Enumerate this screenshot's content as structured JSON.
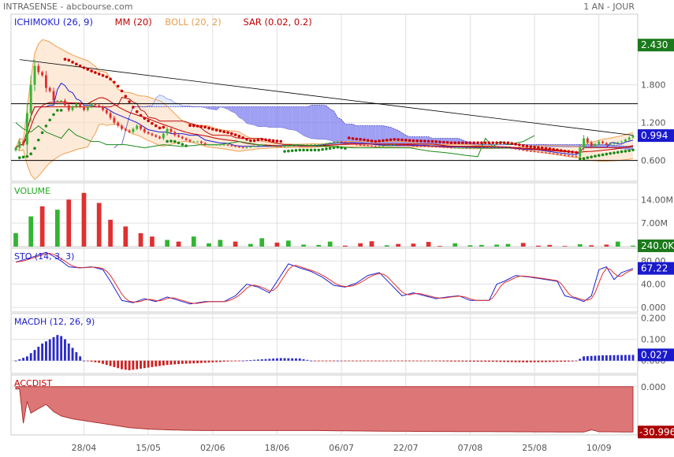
{
  "header": {
    "title": "INTRASENSE - abcbourse.com",
    "period": "1 AN - JOUR"
  },
  "colors": {
    "up": "#33b533",
    "down": "#e03030",
    "sar": "#cc0000",
    "sar_up": "#1a8a1a",
    "ichimoku_tenkan": "#1d1dd8",
    "ichimoku_kijun": "#c01010",
    "ichimoku_chikou": "#1a8a1a",
    "cloud_up": "#7f7ff0",
    "cloud_down": "#d8e6ff",
    "mm": "#c00000",
    "boll": "#f0a050",
    "boll_fill": "#fbdcc0",
    "sto_k": "#2020d0",
    "sto_d": "#e03030",
    "macd_pos": "#2b2bc8",
    "macd_neg": "#cc2222",
    "accdist_fill": "#dd7777",
    "badge_green": "#1b7a1b",
    "badge_blue": "#1a1acc",
    "badge_red": "#aa0000",
    "grid": "#e0e0e0"
  },
  "chart_data": [
    {
      "type": "line",
      "panel": "price",
      "legend": [
        {
          "label": "ICHIMOKU (26, 9)",
          "color": "#1d1dd8"
        },
        {
          "label": "MM (20)",
          "color": "#c00000"
        },
        {
          "label": "BOLL (20, 2)",
          "color": "#e8a050"
        },
        {
          "label": "SAR (0.02, 0.2)",
          "color": "#c00000"
        }
      ],
      "y_ticks": [
        "1.800",
        "1.200",
        "0.600"
      ],
      "y_tick_values": [
        1.8,
        1.2,
        0.6
      ],
      "highlight_values": [
        {
          "label": "2.430",
          "value": 2.43,
          "color": "#1b7a1b"
        },
        {
          "label": "0.994",
          "value": 0.994,
          "color": "#1a1acc"
        }
      ],
      "horizontal_levels": [
        1.5,
        0.6
      ],
      "trendline": [
        {
          "day": 1,
          "value": 2.2
        },
        {
          "day": 163,
          "value": 1.0
        }
      ],
      "ylim": [
        0.27,
        2.92
      ],
      "series_waypoints": {
        "close": [
          [
            0,
            0.8
          ],
          [
            1,
            0.9
          ],
          [
            2,
            0.85
          ],
          [
            3,
            1.35
          ],
          [
            4,
            1.8
          ],
          [
            5,
            2.1
          ],
          [
            6,
            2.0
          ],
          [
            7,
            1.95
          ],
          [
            8,
            1.75
          ],
          [
            9,
            1.7
          ],
          [
            10,
            1.55
          ],
          [
            12,
            1.55
          ],
          [
            14,
            1.4
          ],
          [
            16,
            1.5
          ],
          [
            18,
            1.4
          ],
          [
            20,
            1.5
          ],
          [
            22,
            1.45
          ],
          [
            24,
            1.35
          ],
          [
            26,
            1.2
          ],
          [
            28,
            1.1
          ],
          [
            30,
            1.05
          ],
          [
            32,
            1.15
          ],
          [
            34,
            1.05
          ],
          [
            36,
            1.0
          ],
          [
            38,
            0.95
          ],
          [
            40,
            1.1
          ],
          [
            42,
            1.0
          ],
          [
            44,
            0.95
          ],
          [
            46,
            0.9
          ],
          [
            48,
            0.9
          ],
          [
            50,
            0.85
          ],
          [
            55,
            0.85
          ],
          [
            60,
            0.8
          ],
          [
            65,
            0.85
          ],
          [
            70,
            0.82
          ],
          [
            75,
            0.85
          ],
          [
            80,
            0.85
          ],
          [
            85,
            0.9
          ],
          [
            90,
            0.85
          ],
          [
            95,
            0.82
          ],
          [
            100,
            0.85
          ],
          [
            105,
            0.83
          ],
          [
            110,
            0.82
          ],
          [
            115,
            0.8
          ],
          [
            120,
            0.8
          ],
          [
            125,
            0.8
          ],
          [
            130,
            0.8
          ],
          [
            135,
            0.75
          ],
          [
            140,
            0.72
          ],
          [
            145,
            0.68
          ],
          [
            148,
            0.66
          ],
          [
            150,
            0.95
          ],
          [
            152,
            0.82
          ],
          [
            154,
            0.9
          ],
          [
            156,
            0.85
          ],
          [
            160,
            0.9
          ],
          [
            163,
            0.994
          ]
        ],
        "sto": [
          [
            0,
            78
          ],
          [
            5,
            88
          ],
          [
            8,
            95
          ],
          [
            10,
            88
          ],
          [
            12,
            80
          ],
          [
            14,
            70
          ],
          [
            17,
            68
          ],
          [
            20,
            70
          ],
          [
            23,
            65
          ],
          [
            25,
            45
          ],
          [
            28,
            12
          ],
          [
            31,
            8
          ],
          [
            34,
            15
          ],
          [
            37,
            10
          ],
          [
            40,
            18
          ],
          [
            43,
            12
          ],
          [
            46,
            6
          ],
          [
            50,
            10
          ],
          [
            55,
            10
          ],
          [
            58,
            20
          ],
          [
            61,
            40
          ],
          [
            64,
            35
          ],
          [
            67,
            25
          ],
          [
            70,
            55
          ],
          [
            72,
            75
          ],
          [
            75,
            68
          ],
          [
            78,
            62
          ],
          [
            81,
            52
          ],
          [
            84,
            38
          ],
          [
            87,
            35
          ],
          [
            90,
            42
          ],
          [
            93,
            55
          ],
          [
            96,
            60
          ],
          [
            99,
            40
          ],
          [
            102,
            20
          ],
          [
            105,
            25
          ],
          [
            108,
            20
          ],
          [
            111,
            15
          ],
          [
            114,
            18
          ],
          [
            117,
            20
          ],
          [
            120,
            12
          ],
          [
            125,
            12
          ],
          [
            127,
            40
          ],
          [
            129,
            45
          ],
          [
            132,
            55
          ],
          [
            136,
            52
          ],
          [
            140,
            48
          ],
          [
            143,
            45
          ],
          [
            145,
            20
          ],
          [
            148,
            15
          ],
          [
            150,
            10
          ],
          [
            152,
            20
          ],
          [
            154,
            65
          ],
          [
            156,
            70
          ],
          [
            158,
            48
          ],
          [
            160,
            60
          ],
          [
            163,
            67
          ]
        ],
        "accdist": [
          [
            0,
            -1.5
          ],
          [
            1,
            -1.5
          ],
          [
            2,
            -25
          ],
          [
            3,
            -10
          ],
          [
            4,
            -18
          ],
          [
            6,
            -15
          ],
          [
            8,
            -12
          ],
          [
            10,
            -17
          ],
          [
            12,
            -20
          ],
          [
            15,
            -22
          ],
          [
            20,
            -24
          ],
          [
            25,
            -26
          ],
          [
            30,
            -28
          ],
          [
            35,
            -29
          ],
          [
            40,
            -29.5
          ],
          [
            45,
            -29.8
          ],
          [
            50,
            -30
          ],
          [
            80,
            -30
          ],
          [
            100,
            -30.5
          ],
          [
            130,
            -30.8
          ],
          [
            150,
            -31
          ],
          [
            152,
            -29.5
          ],
          [
            154,
            -30.8
          ],
          [
            163,
            -30.996
          ]
        ]
      }
    },
    {
      "type": "bar",
      "panel": "volume",
      "title": "VOLUME",
      "y_ticks": [
        "14.00M",
        "7.00M"
      ],
      "y_tick_values": [
        14,
        7
      ],
      "highlight_values": [
        {
          "label": "240.0K",
          "value": 0.24,
          "color": "#1b7a1b"
        }
      ],
      "ylim": [
        0,
        19
      ],
      "values_millions": [
        4,
        9,
        12,
        11,
        14,
        16,
        13,
        8,
        6,
        4,
        3,
        2,
        1.5,
        3,
        1,
        2,
        1.5,
        0.8,
        2.5,
        1.2,
        1.8,
        0.6,
        0.5,
        1.5,
        0.3,
        1.0,
        1.6,
        0.4,
        0.8,
        0.9,
        1.4,
        0.2,
        1.0,
        0.4,
        0.5,
        0.6,
        0.8,
        1.1,
        0.3,
        0.5,
        0.2,
        0.7,
        0.4,
        0.6,
        1.5,
        0.3
      ]
    },
    {
      "type": "line",
      "panel": "stochastic",
      "title": "STO (14, 3, 3)",
      "y_ticks": [
        "80.00",
        "40.00",
        "0.000"
      ],
      "y_tick_values": [
        80,
        40,
        0
      ],
      "highlight_values": [
        {
          "label": "67.22",
          "value": 67.22,
          "color": "#1a1acc"
        }
      ],
      "ylim": [
        -8,
        102
      ],
      "series": [
        {
          "name": "%K",
          "color": "#2020d0"
        },
        {
          "name": "%D",
          "color": "#e03030"
        }
      ]
    },
    {
      "type": "bar",
      "panel": "macd",
      "title": "MACDH (12, 26, 9)",
      "y_ticks": [
        "0.200",
        "0.100",
        "0.000"
      ],
      "y_tick_values": [
        0.2,
        0.1,
        0.0
      ],
      "highlight_values": [
        {
          "label": "0.027",
          "value": 0.027,
          "color": "#1a1acc"
        }
      ],
      "ylim": [
        -0.06,
        0.22
      ],
      "waypoints": [
        [
          0,
          0.0
        ],
        [
          3,
          0.02
        ],
        [
          5,
          0.05
        ],
        [
          7,
          0.08
        ],
        [
          9,
          0.1
        ],
        [
          11,
          0.12
        ],
        [
          12,
          0.115
        ],
        [
          13,
          0.1
        ],
        [
          14,
          0.08
        ],
        [
          15,
          0.06
        ],
        [
          16,
          0.04
        ],
        [
          17,
          0.02
        ],
        [
          18,
          0.0
        ],
        [
          20,
          -0.005
        ],
        [
          22,
          -0.01
        ],
        [
          24,
          -0.02
        ],
        [
          26,
          -0.03
        ],
        [
          28,
          -0.04
        ],
        [
          30,
          -0.045
        ],
        [
          32,
          -0.04
        ],
        [
          34,
          -0.035
        ],
        [
          36,
          -0.03
        ],
        [
          38,
          -0.025
        ],
        [
          40,
          -0.02
        ],
        [
          44,
          -0.015
        ],
        [
          48,
          -0.012
        ],
        [
          52,
          -0.008
        ],
        [
          56,
          -0.004
        ],
        [
          60,
          0.0
        ],
        [
          64,
          0.005
        ],
        [
          70,
          0.012
        ],
        [
          75,
          0.01
        ],
        [
          78,
          0.0
        ],
        [
          80,
          -0.002
        ],
        [
          85,
          0.0
        ],
        [
          95,
          -0.003
        ],
        [
          105,
          -0.002
        ],
        [
          115,
          -0.004
        ],
        [
          125,
          -0.005
        ],
        [
          135,
          -0.008
        ],
        [
          145,
          -0.005
        ],
        [
          148,
          -0.003
        ],
        [
          150,
          0.02
        ],
        [
          155,
          0.025
        ],
        [
          163,
          0.027
        ]
      ]
    },
    {
      "type": "area",
      "panel": "accdist",
      "title": "ACCDIST",
      "y_ticks": [
        "0.000"
      ],
      "y_tick_values": [
        0
      ],
      "highlight_values": [
        {
          "label": "-30.996",
          "value": -30.996,
          "color": "#aa0000"
        }
      ],
      "ylim": [
        -33,
        8
      ]
    }
  ],
  "x_ticks": [
    {
      "label": "28/04",
      "day": 18
    },
    {
      "label": "15/05",
      "day": 35
    },
    {
      "label": "02/06",
      "day": 52
    },
    {
      "label": "18/06",
      "day": 69
    },
    {
      "label": "06/07",
      "day": 86
    },
    {
      "label": "22/07",
      "day": 103
    },
    {
      "label": "07/08",
      "day": 120
    },
    {
      "label": "25/08",
      "day": 137
    },
    {
      "label": "10/09",
      "day": 154
    }
  ]
}
